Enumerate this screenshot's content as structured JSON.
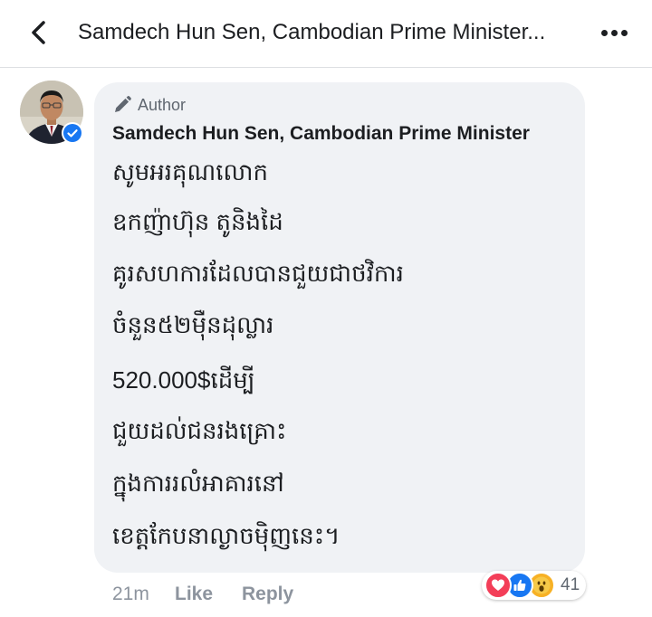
{
  "header": {
    "title": "Samdech Hun Sen, Cambodian Prime Minister...",
    "back_icon": "chevron-left-icon",
    "more_icon": "more-horizontal-icon"
  },
  "comment": {
    "author_badge": "Author",
    "author_icon": "pencil-icon",
    "author_name": "Samdech Hun Sen, Cambodian Prime Minister",
    "verified_icon": "verified-check-icon",
    "lines": [
      "សូមអរគុណលោក",
      "ឧកញ៉ាហ៊ុន តូនិងដៃ",
      "គូរសហការដែលបានជួយជាថវិការ",
      "ចំនួន៥២ម៉ឺនដុល្លារ",
      "520.000$ដើម្បី",
      "ជួយដល់ជនរងគ្រោះ",
      "ក្នុងការរលំអាគារនៅ",
      "ខេត្តកែបនាល្ងាចម៉ិញនេះ។"
    ],
    "time": "21m",
    "like_label": "Like",
    "reply_label": "Reply",
    "reactions": {
      "types": [
        "love",
        "like",
        "wow"
      ],
      "count": "41"
    }
  },
  "colors": {
    "bubble": "#f0f2f5",
    "muted_text": "#8d949e",
    "like_blue": "#1877f2",
    "love_red": "#f33e58",
    "wow_yellow": "#f7b125"
  }
}
